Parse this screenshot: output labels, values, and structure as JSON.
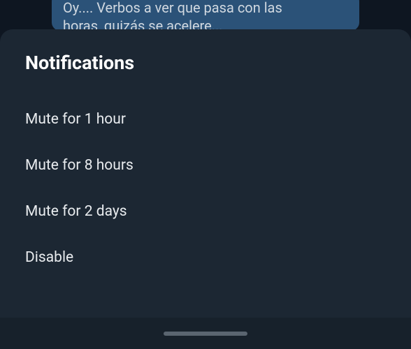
{
  "chat": {
    "message_line1": "Oy.... Verbos a ver que pasa con las",
    "message_line2": "horas, quizás se acelere..."
  },
  "sheet": {
    "title": "Notifications",
    "options": [
      {
        "label": "Mute for 1 hour"
      },
      {
        "label": "Mute for 8 hours"
      },
      {
        "label": "Mute for 2 days"
      },
      {
        "label": "Disable"
      }
    ]
  }
}
